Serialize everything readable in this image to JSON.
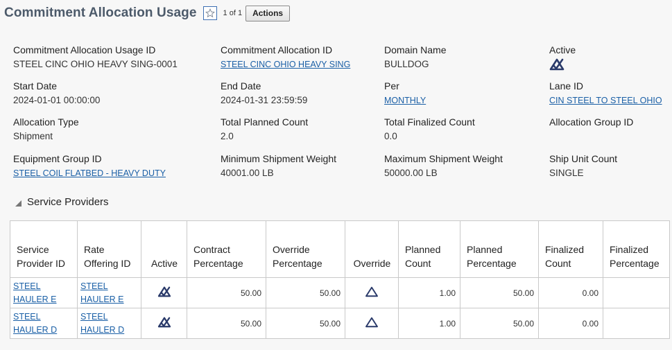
{
  "header": {
    "title": "Commitment Allocation Usage",
    "page_count": "1 of 1",
    "actions_label": "Actions",
    "favorite_icon": "star-icon"
  },
  "fields": {
    "usage_id": {
      "label": "Commitment Allocation Usage ID",
      "value": "STEEL CINC OHIO HEAVY SING-0001"
    },
    "allocation_id": {
      "label": "Commitment Allocation ID",
      "value": "STEEL CINC OHIO HEAVY SING"
    },
    "domain_name": {
      "label": "Domain Name",
      "value": "BULLDOG"
    },
    "active": {
      "label": "Active",
      "icon": "checkmark-active-icon"
    },
    "start_date": {
      "label": "Start Date",
      "value": "2024-01-01 00:00:00"
    },
    "end_date": {
      "label": "End Date",
      "value": "2024-01-31 23:59:59"
    },
    "per": {
      "label": "Per",
      "value": "MONTHLY"
    },
    "lane_id": {
      "label": "Lane ID",
      "value": "CIN STEEL TO STEEL OHIO"
    },
    "allocation_type": {
      "label": "Allocation Type",
      "value": "Shipment"
    },
    "total_planned": {
      "label": "Total Planned Count",
      "value": "2.0"
    },
    "total_finalized": {
      "label": "Total Finalized Count",
      "value": "0.0"
    },
    "allocation_group": {
      "label": "Allocation Group ID",
      "value": ""
    },
    "equipment_group": {
      "label": "Equipment Group ID",
      "value": "STEEL COIL FLATBED - HEAVY DUTY"
    },
    "min_weight": {
      "label": "Minimum Shipment Weight",
      "value": "40001.00 LB"
    },
    "max_weight": {
      "label": "Maximum Shipment Weight",
      "value": "50000.00 LB"
    },
    "ship_unit": {
      "label": "Ship Unit Count",
      "value": "SINGLE"
    }
  },
  "service_providers": {
    "title": "Service Providers",
    "columns": [
      "Service Provider ID",
      "Rate Offering ID",
      "Active",
      "Contract Percentage",
      "Override Percentage",
      "Override",
      "Planned Count",
      "Planned Percentage",
      "Finalized Count",
      "Finalized Percentage"
    ],
    "rows": [
      {
        "provider": "STEEL HAULER E",
        "rate_offering": "STEEL HAULER E",
        "active_icon": "checkmark-active-icon",
        "contract_pct": "50.00",
        "override_pct": "50.00",
        "override_icon": "triangle-icon",
        "planned_count": "1.00",
        "planned_pct": "50.00",
        "finalized_count": "0.00",
        "finalized_pct": ""
      },
      {
        "provider": "STEEL HAULER D",
        "rate_offering": "STEEL HAULER D",
        "active_icon": "checkmark-active-icon",
        "contract_pct": "50.00",
        "override_pct": "50.00",
        "override_icon": "triangle-icon",
        "planned_count": "1.00",
        "planned_pct": "50.00",
        "finalized_count": "0.00",
        "finalized_pct": ""
      }
    ]
  },
  "colors": {
    "title": "#4c5a6a",
    "link": "#1a5fa6",
    "icon": "#2a3a6a"
  }
}
